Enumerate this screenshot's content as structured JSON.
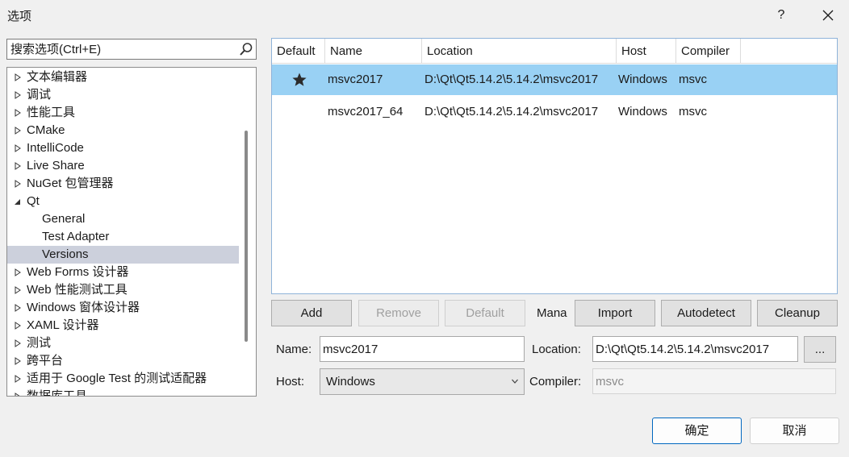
{
  "window": {
    "title": "选项",
    "help_label": "?"
  },
  "search": {
    "placeholder": "搜索选项(Ctrl+E)"
  },
  "tree": {
    "items": [
      {
        "label": "文本编辑器",
        "state": "collapsed"
      },
      {
        "label": "调试",
        "state": "collapsed"
      },
      {
        "label": "性能工具",
        "state": "collapsed"
      },
      {
        "label": "CMake",
        "state": "collapsed"
      },
      {
        "label": "IntelliCode",
        "state": "collapsed"
      },
      {
        "label": "Live Share",
        "state": "collapsed"
      },
      {
        "label": "NuGet 包管理器",
        "state": "collapsed"
      },
      {
        "label": "Qt",
        "state": "expanded"
      },
      {
        "label": "General",
        "state": "child"
      },
      {
        "label": "Test Adapter",
        "state": "child"
      },
      {
        "label": "Versions",
        "state": "child-selected"
      },
      {
        "label": "Web Forms 设计器",
        "state": "collapsed"
      },
      {
        "label": "Web 性能测试工具",
        "state": "collapsed"
      },
      {
        "label": "Windows 窗体设计器",
        "state": "collapsed"
      },
      {
        "label": "XAML 设计器",
        "state": "collapsed"
      },
      {
        "label": "测试",
        "state": "collapsed"
      },
      {
        "label": "跨平台",
        "state": "collapsed"
      },
      {
        "label": "适用于 Google Test 的测试适配器",
        "state": "collapsed"
      },
      {
        "label": "数据库工具",
        "state": "collapsed"
      }
    ]
  },
  "versions_table": {
    "columns": [
      "Default",
      "Name",
      "Location",
      "Host",
      "Compiler"
    ],
    "rows": [
      {
        "is_default": true,
        "name": "msvc2017",
        "location": "D:\\Qt\\Qt5.14.2\\5.14.2\\msvc2017",
        "host": "Windows",
        "compiler": "msvc",
        "selected": true
      },
      {
        "is_default": false,
        "name": "msvc2017_64",
        "location": "D:\\Qt\\Qt5.14.2\\5.14.2\\msvc2017",
        "host": "Windows",
        "compiler": "msvc",
        "selected": false
      }
    ]
  },
  "actions": {
    "add": "Add",
    "remove": "Remove",
    "default": "Default",
    "mana_label": "Mana",
    "import": "Import",
    "autodetect": "Autodetect",
    "cleanup": "Cleanup"
  },
  "form": {
    "name_label": "Name:",
    "name_value": "msvc2017",
    "location_label": "Location:",
    "location_value": "D:\\Qt\\Qt5.14.2\\5.14.2\\msvc2017",
    "browse_label": "...",
    "host_label": "Host:",
    "host_value": "Windows",
    "compiler_label": "Compiler:",
    "compiler_value": "msvc"
  },
  "footer": {
    "ok": "确定",
    "cancel": "取消"
  },
  "colors": {
    "selection_row": "#99d1f4",
    "tree_selection": "#ccd0dc",
    "primary_border": "#0067c0"
  },
  "icons": {
    "search": "search-icon",
    "close": "close-icon",
    "default_marker": "star-icon",
    "dropdown": "chevron-down-icon"
  }
}
